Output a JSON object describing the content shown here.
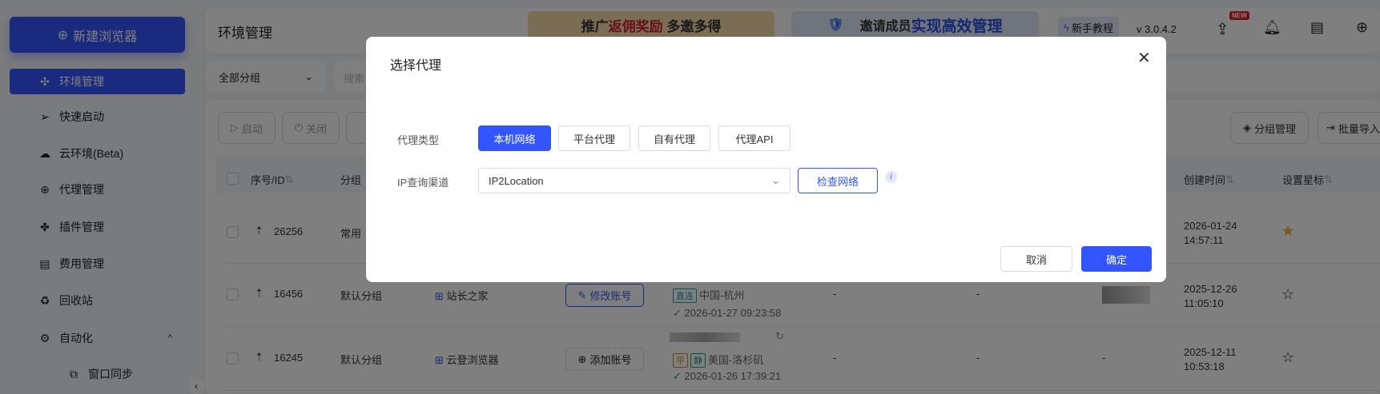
{
  "sidebar": {
    "new_button": "新建浏览器",
    "items": [
      {
        "label": "环境管理",
        "icon": "cluster-icon",
        "active": true
      },
      {
        "label": "快速启动",
        "icon": "send-icon"
      },
      {
        "label": "云环境(Beta)",
        "icon": "cloud-icon"
      },
      {
        "label": "代理管理",
        "icon": "globe-icon"
      },
      {
        "label": "插件管理",
        "icon": "puzzle-icon"
      },
      {
        "label": "费用管理",
        "icon": "billing-icon"
      },
      {
        "label": "回收站",
        "icon": "recycle-icon"
      },
      {
        "label": "自动化",
        "icon": "automation-icon",
        "expanded": true
      },
      {
        "label": "窗口同步",
        "icon": "window-sync-icon"
      }
    ]
  },
  "header": {
    "title": "环境管理",
    "banner1_a": "推广",
    "banner1_b": "返佣奖励",
    "banner1_c": "多邀多得",
    "banner2_a": "邀请成员",
    "banner2_b": "实现高效管理",
    "tutorial": "新手教程",
    "version": "v 3.0.4.2",
    "new_badge": "NEW"
  },
  "filters": {
    "group_select": "全部分组",
    "search_placeholder": "搜索"
  },
  "toolbar": {
    "start": "启动",
    "close": "关闭",
    "group_manage": "分组管理",
    "batch_import": "批量导入"
  },
  "table": {
    "headers": {
      "id": "序号/ID",
      "group": "分组",
      "created": "创建时间",
      "star": "设置星标"
    },
    "rows": [
      {
        "id": "26256",
        "group": "常用",
        "created_date": "2026-01-24",
        "created_time": "14:57:11",
        "starred": true
      },
      {
        "id": "16456",
        "group": "默认分组",
        "name": "站长之家",
        "account_btn": "修改账号",
        "tags": [
          "直连"
        ],
        "location": "中国-杭州",
        "checked_at": "2026-01-27 09:23:58",
        "col6": "-",
        "col7": "-",
        "created_date": "2025-12-26",
        "created_time": "11:05:10",
        "starred": false
      },
      {
        "id": "16245",
        "group": "默认分组",
        "name": "云登浏览器",
        "account_btn": "添加账号",
        "tags": [
          "平",
          "静"
        ],
        "location": "美国-洛杉矶",
        "checked_at": "2026-01-26 17:39:21",
        "col6": "-",
        "col7": "-",
        "col8": "-",
        "created_date": "2025-12-11",
        "created_time": "10:53:18",
        "starred": false
      }
    ]
  },
  "modal": {
    "title": "选择代理",
    "proxy_type_label": "代理类型",
    "proxy_types": [
      "本机网络",
      "平台代理",
      "自有代理",
      "代理API"
    ],
    "selected_type": "本机网络",
    "ip_channel_label": "IP查询渠道",
    "ip_channel_value": "IP2Location",
    "check_button": "检查网络",
    "cancel": "取消",
    "confirm": "确定"
  },
  "colors": {
    "primary": "#3355ff",
    "star": "#f0b323",
    "new_badge": "#e02020"
  }
}
